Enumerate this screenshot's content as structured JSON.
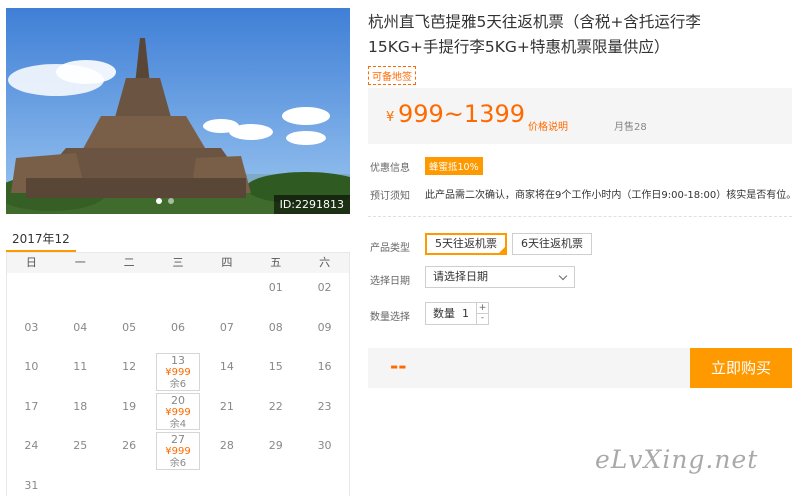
{
  "photo": {
    "id_label": "ID:2291813",
    "slide_count": 2,
    "active_slide": 1
  },
  "product": {
    "title_line1": "杭州直飞芭提雅5天往返机票（含税+含托运行李",
    "title_line2": "15KG+手提行李5KG+特惠机票限量供应）",
    "tag": "可备地签",
    "price": {
      "currency": "¥",
      "range": "999~1399",
      "note": "价格说明",
      "monthly_sales": "月售28"
    },
    "promo": {
      "label": "优惠信息",
      "badge": "蜂蜜抵10%"
    },
    "notice": {
      "label": "预订须知",
      "text": "此产品需二次确认，商家将在9个工作小时内（工作日9:00-18:00）核实是否有位。"
    },
    "type": {
      "label": "产品类型",
      "options": [
        "5天往返机票",
        "6天往返机票"
      ],
      "selected": 0
    },
    "date": {
      "label": "选择日期",
      "placeholder": "请选择日期"
    },
    "quantity": {
      "label": "数量选择",
      "prefix": "数量",
      "value": "1",
      "plus": "+",
      "minus": "-"
    },
    "total": "--",
    "buy_label": "立即购买"
  },
  "calendar": {
    "month": "2017年12月",
    "weekdays": [
      "日",
      "一",
      "二",
      "三",
      "四",
      "五",
      "六"
    ],
    "days": [
      {
        "d": ""
      },
      {
        "d": ""
      },
      {
        "d": ""
      },
      {
        "d": ""
      },
      {
        "d": ""
      },
      {
        "d": "01"
      },
      {
        "d": "02"
      },
      {
        "d": "03"
      },
      {
        "d": "04"
      },
      {
        "d": "05"
      },
      {
        "d": "06"
      },
      {
        "d": "07"
      },
      {
        "d": "08"
      },
      {
        "d": "09"
      },
      {
        "d": "10"
      },
      {
        "d": "11"
      },
      {
        "d": "12"
      },
      {
        "d": "13",
        "price": "¥999",
        "stock": "余6"
      },
      {
        "d": "14"
      },
      {
        "d": "15"
      },
      {
        "d": "16"
      },
      {
        "d": "17"
      },
      {
        "d": "18"
      },
      {
        "d": "19"
      },
      {
        "d": "20",
        "price": "¥999",
        "stock": "余4"
      },
      {
        "d": "21"
      },
      {
        "d": "22"
      },
      {
        "d": "23"
      },
      {
        "d": "24"
      },
      {
        "d": "25"
      },
      {
        "d": "26"
      },
      {
        "d": "27",
        "price": "¥999",
        "stock": "余6"
      },
      {
        "d": "28"
      },
      {
        "d": "29"
      },
      {
        "d": "30"
      },
      {
        "d": "31"
      }
    ]
  },
  "watermark": "eLvXing.net"
}
